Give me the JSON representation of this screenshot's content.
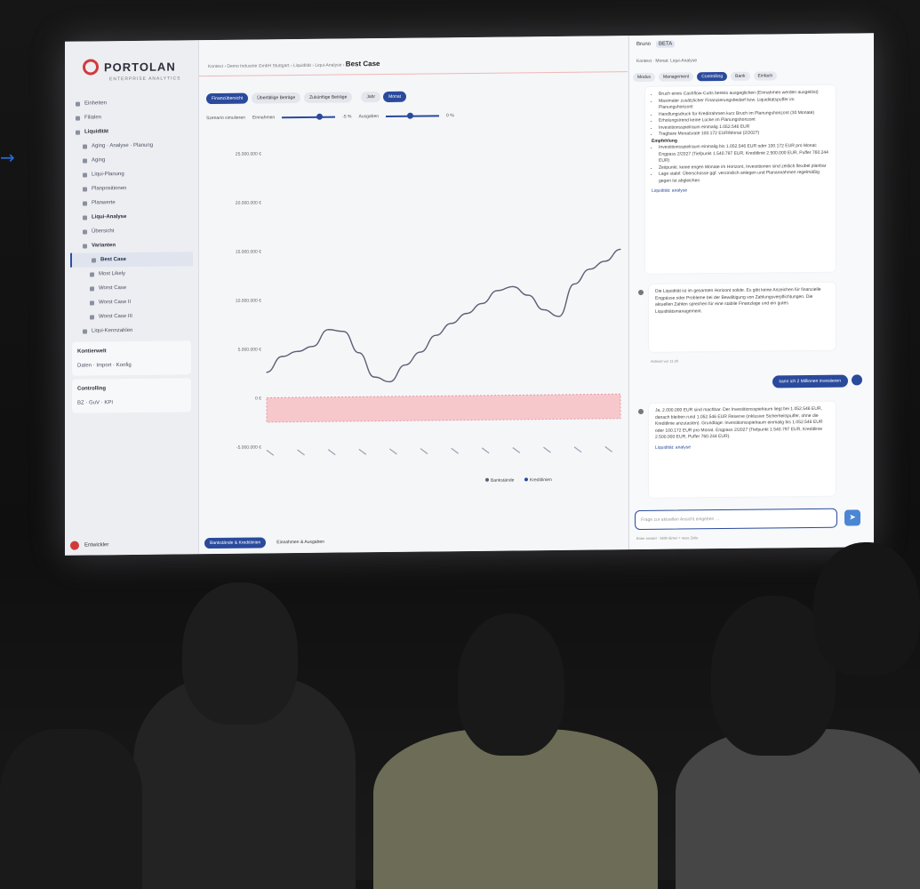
{
  "pointer": {
    "glyph": "→"
  },
  "app": {
    "logo_text": "PORTOLAN",
    "logo_subtitle": "ENTERPRISE ANALYTICS",
    "breadcrumb_path": "Kontext  ›  Demo Industrie GmbH Stuttgart  ›  Liquidität  ›  Liqui-Analyse  ›",
    "page_title": "Best Case"
  },
  "sidebar": {
    "items": [
      {
        "label": "Einheiten",
        "level": 0
      },
      {
        "label": "Filialen",
        "level": 0
      },
      {
        "label": "Liquidität",
        "level": 0,
        "bold": true
      },
      {
        "label": "Aging · Analyse · Planung",
        "level": 1
      },
      {
        "label": "Aging",
        "level": 1
      },
      {
        "label": "Liqui-Planung",
        "level": 1
      },
      {
        "label": "Planpositionen",
        "level": 2
      },
      {
        "label": "Planwerte",
        "level": 2
      },
      {
        "label": "Liqui-Analyse",
        "level": 1,
        "bold": true
      },
      {
        "label": "Übersicht",
        "level": 2
      },
      {
        "label": "Varianten",
        "level": 2,
        "bold": true
      },
      {
        "label": "Best Case",
        "level": 3,
        "active": true
      },
      {
        "label": "Most Likely",
        "level": 3
      },
      {
        "label": "Worst Case",
        "level": 3
      },
      {
        "label": "Worst Case II",
        "level": 3
      },
      {
        "label": "Worst Case III",
        "level": 3
      },
      {
        "label": "Liqui-Kennzahlen",
        "level": 1
      }
    ],
    "cards": [
      {
        "title": "Kontierwelt",
        "subtitle": "Daten · Import · Konfig"
      },
      {
        "title": "Controlling",
        "subtitle": "BZ · GuV · KPI"
      }
    ],
    "user_name": "Entwickler"
  },
  "main": {
    "tabs": [
      "Finanzübersicht",
      "Überfällige Beträge",
      "Zukünftige Beträge"
    ],
    "active_tab_index": 0,
    "period_toggle": [
      "Jahr",
      "Monat"
    ],
    "active_period_index": 1,
    "scenario_label": "Szenario simulieren",
    "slider_1_label": "Einnahmen",
    "slider_1_value": "-5 %",
    "slider_1_level": 0.7,
    "slider_2_label": "Ausgaben",
    "slider_2_value": "0 %",
    "slider_2_level": 0.45,
    "bottom_tabs": [
      "Bankstände & Kreditlinien",
      "Einnahmen & Ausgaben"
    ]
  },
  "chart_data": {
    "type": "line",
    "title": "",
    "y_ticks": [
      "25.000.000 €",
      "20.000.000 €",
      "15.000.000 €",
      "10.000.000 €",
      "5.000.000 €",
      "0 €",
      "-5.000.000 €"
    ],
    "ylim": [
      -5000000,
      25000000
    ],
    "series": [
      {
        "name": "Bankstände",
        "color": "#5a6075",
        "x": [
          0,
          1,
          2,
          3,
          4,
          5,
          6,
          7,
          8,
          9,
          10,
          11,
          12,
          13,
          14,
          15,
          16,
          17,
          18,
          19,
          20,
          21,
          22,
          23
        ],
        "values": [
          2600000,
          4200000,
          4700000,
          5200000,
          6900000,
          6700000,
          4500000,
          2000000,
          1500000,
          3200000,
          4500000,
          6200000,
          7400000,
          8400000,
          9400000,
          10700000,
          11100000,
          10200000,
          8700000,
          8000000,
          11300000,
          12800000,
          13600000,
          14800000
        ]
      },
      {
        "name": "Kreditlinien",
        "color": "#2a4a9c"
      }
    ],
    "credit_band": [
      -2500000,
      0
    ],
    "legend": [
      "Bankstände",
      "Kreditlinien"
    ],
    "legend_position": "bottom-right"
  },
  "chat": {
    "assistant_name": "Bruno",
    "assistant_badge": "BETA",
    "breadcrumb": "Kontext · Monat: Liqui-Analyse",
    "tabs": [
      "Modus",
      "Management",
      "Controlling",
      "Bank",
      "Einfach"
    ],
    "active_tab_index": 2,
    "msg1_bullets": [
      "Bruch eines Cashflow-Cutts bereits ausgeglichen (Einnahmen werden ausgelöst)",
      "Maximaler zusätzlicher Finanzierungsbedarf bzw. Liquiditätspuffer im Planungshorizont",
      "Handlungsdruck für Kreditrahmen kurz Bruch im Planungshorizont (30 Monate)",
      "Erholungstrend keine Lücke im Planungshorizont",
      "Investitionsspielraum einmalig 1.052.546 EUR",
      "Tragbare Monatsrate 100.172 EUR/Monat (2/2027)"
    ],
    "msg1_heading": "Empfehlung",
    "msg1_recs": [
      "Investitionsspielraum einmalig bis 1.052.546 EUR oder 100.172 EUR pro Monat: Engpass 2/2027 (Tiefpunkt 1.540.797 EUR, Kreditlinie 2.500.000 EUR, Puffer 760.244 EUR)",
      "Zeitpunkt: keine engen Monate im Horizont, Investitionen sind zeitlich flexibel planbar",
      "Lage stabil: Überschüsse ggf. verzinslich anlegen und Planannahmen regelmäßig gegen Ist abgleichen"
    ],
    "msg1_link": "Liquidität: analyse",
    "msg2_text": "Die Liquidität ist im gesamten Horizont solide. Es gibt keine Anzeichen für finanzielle Engpässe oder Probleme bei der Bewältigung von Zahlungsverpflichtungen. Die aktuellen Zahlen sprechen für eine stabile Finanzlage und ein gutes Liquiditätsmanagement.",
    "msg2_meta": "Antwort vor 11:30",
    "user_msg": "kann ich 2 Millionen investieren",
    "msg3_text": "Ja, 2.000.000 EUR sind machbar. Der Investitionsspielraum liegt bei 1.052.546 EUR, danach bleiben rund 1.052.546 EUR Reserve (inklusive Sicherheitspuffer, ohne die Kreditlinie anzutasten). Grundlage: Investitionsspielraum einmalig bis 1.052.546 EUR oder 100.172 EUR pro Monat. Engpass 2/2027 (Tiefpunkt 1.540.797 EUR, Kreditlinie 2.500.000 EUR, Puffer 760.244 EUR).",
    "msg3_link": "Liquidität: analyse",
    "input_placeholder": "Frage zur aktuellen Ansicht eingeben …",
    "footer": "Enter sendet · Shift+Enter = neue Zeile",
    "send_icon": "➤"
  }
}
